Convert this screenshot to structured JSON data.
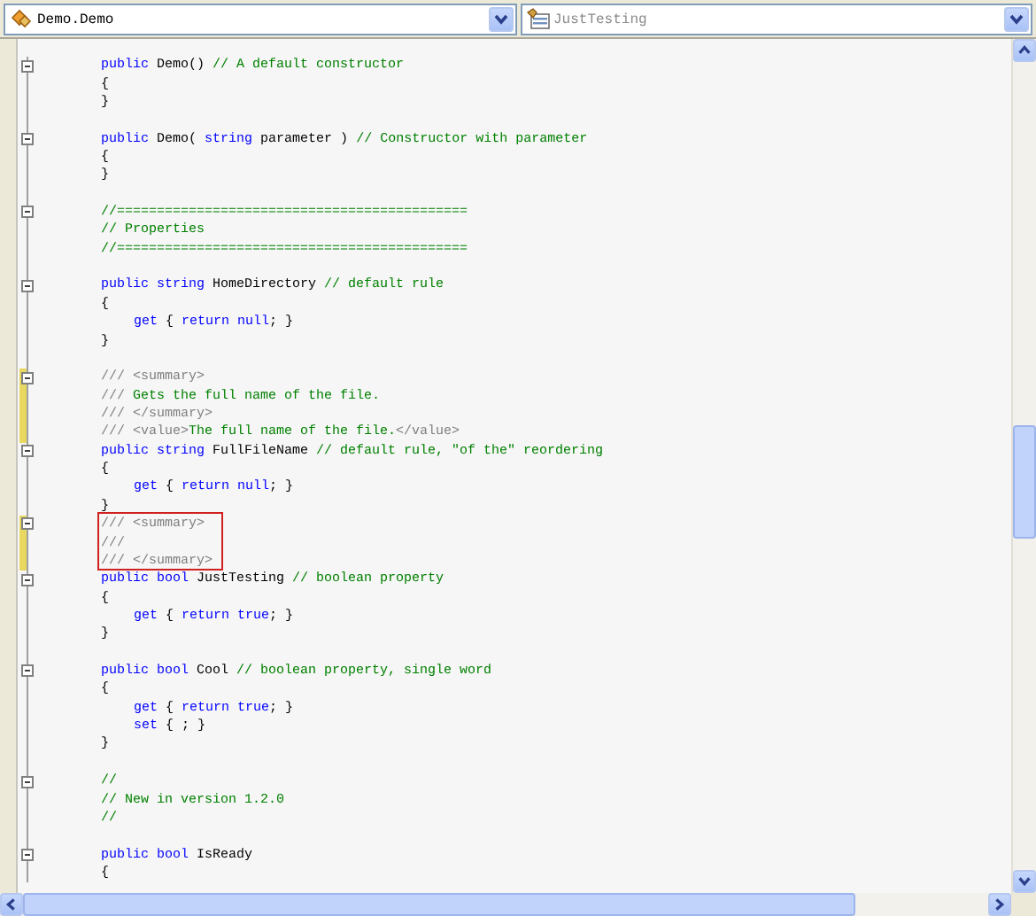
{
  "navigation_bar": {
    "type_dropdown": {
      "text": "Demo.Demo",
      "greyed": false
    },
    "member_dropdown": {
      "text": "JustTesting",
      "greyed": true
    }
  },
  "editor": {
    "lines": [
      {
        "fold": true,
        "modified": false,
        "boxed": false,
        "indented": false,
        "segments": [
          {
            "kind": "keyword",
            "text": "public"
          },
          {
            "kind": "plain",
            "text": " Demo() "
          },
          {
            "kind": "comment",
            "text": "// A default constructor"
          }
        ]
      },
      {
        "fold": false,
        "modified": false,
        "boxed": false,
        "indented": false,
        "segments": [
          {
            "kind": "plain",
            "text": "{"
          }
        ]
      },
      {
        "fold": false,
        "modified": false,
        "boxed": false,
        "indented": false,
        "segments": [
          {
            "kind": "plain",
            "text": "}"
          }
        ]
      },
      {
        "fold": false,
        "modified": false,
        "boxed": false
      },
      {
        "fold": true,
        "modified": false,
        "boxed": false,
        "indented": false,
        "segments": [
          {
            "kind": "keyword",
            "text": "public"
          },
          {
            "kind": "plain",
            "text": " Demo( "
          },
          {
            "kind": "keyword",
            "text": "string"
          },
          {
            "kind": "plain",
            "text": " parameter ) "
          },
          {
            "kind": "comment",
            "text": "// Constructor with parameter"
          }
        ]
      },
      {
        "fold": false,
        "modified": false,
        "boxed": false,
        "indented": false,
        "segments": [
          {
            "kind": "plain",
            "text": "{"
          }
        ]
      },
      {
        "fold": false,
        "modified": false,
        "boxed": false,
        "indented": false,
        "segments": [
          {
            "kind": "plain",
            "text": "}"
          }
        ]
      },
      {
        "fold": false,
        "modified": false,
        "boxed": false
      },
      {
        "fold": true,
        "modified": false,
        "boxed": false,
        "indented": false,
        "segments": [
          {
            "kind": "comment",
            "text": "//============================================"
          }
        ]
      },
      {
        "fold": false,
        "modified": false,
        "boxed": false,
        "indented": false,
        "segments": [
          {
            "kind": "comment",
            "text": "// Properties"
          }
        ]
      },
      {
        "fold": false,
        "modified": false,
        "boxed": false,
        "indented": false,
        "segments": [
          {
            "kind": "comment",
            "text": "//============================================"
          }
        ]
      },
      {
        "fold": false,
        "modified": false,
        "boxed": false
      },
      {
        "fold": true,
        "modified": false,
        "boxed": false,
        "indented": false,
        "segments": [
          {
            "kind": "keyword",
            "text": "public string"
          },
          {
            "kind": "plain",
            "text": " HomeDirectory "
          },
          {
            "kind": "comment",
            "text": "// default rule"
          }
        ]
      },
      {
        "fold": false,
        "modified": false,
        "boxed": false,
        "indented": false,
        "segments": [
          {
            "kind": "plain",
            "text": "{"
          }
        ]
      },
      {
        "fold": false,
        "modified": false,
        "boxed": false,
        "indented": true,
        "segments": [
          {
            "kind": "keyword",
            "text": "get"
          },
          {
            "kind": "plain",
            "text": " { "
          },
          {
            "kind": "keyword",
            "text": "return null"
          },
          {
            "kind": "plain",
            "text": "; }"
          }
        ]
      },
      {
        "fold": false,
        "modified": false,
        "boxed": false,
        "indented": false,
        "segments": [
          {
            "kind": "plain",
            "text": "}"
          }
        ]
      },
      {
        "fold": false,
        "modified": false,
        "boxed": false
      },
      {
        "fold": true,
        "modified": true,
        "boxed": false,
        "indented": false,
        "segments": [
          {
            "kind": "doc",
            "text": "/// <summary>"
          }
        ]
      },
      {
        "fold": false,
        "modified": true,
        "boxed": false,
        "indented": false,
        "segments": [
          {
            "kind": "doc",
            "text": "///"
          },
          {
            "kind": "comment",
            "text": " Gets the full name of the file."
          }
        ]
      },
      {
        "fold": false,
        "modified": true,
        "boxed": false,
        "indented": false,
        "segments": [
          {
            "kind": "doc",
            "text": "/// </summary>"
          }
        ]
      },
      {
        "fold": false,
        "modified": true,
        "boxed": false,
        "indented": false,
        "segments": [
          {
            "kind": "doc",
            "text": "/// <value>"
          },
          {
            "kind": "comment",
            "text": "The full name of the file."
          },
          {
            "kind": "doc",
            "text": "</value>"
          }
        ]
      },
      {
        "fold": true,
        "modified": false,
        "boxed": false,
        "indented": false,
        "segments": [
          {
            "kind": "keyword",
            "text": "public string"
          },
          {
            "kind": "plain",
            "text": " FullFileName "
          },
          {
            "kind": "comment",
            "text": "// default rule, \"of the\" reordering"
          }
        ]
      },
      {
        "fold": false,
        "modified": false,
        "boxed": false,
        "indented": false,
        "segments": [
          {
            "kind": "plain",
            "text": "{"
          }
        ]
      },
      {
        "fold": false,
        "modified": false,
        "boxed": false,
        "indented": true,
        "segments": [
          {
            "kind": "keyword",
            "text": "get"
          },
          {
            "kind": "plain",
            "text": " { "
          },
          {
            "kind": "keyword",
            "text": "return null"
          },
          {
            "kind": "plain",
            "text": "; }"
          }
        ]
      },
      {
        "fold": false,
        "modified": false,
        "boxed": false,
        "indented": false,
        "segments": [
          {
            "kind": "plain",
            "text": "}"
          }
        ]
      },
      {
        "fold": true,
        "modified": true,
        "boxed": true,
        "indented": false,
        "segments": [
          {
            "kind": "doc",
            "text": "/// <summary>"
          }
        ]
      },
      {
        "fold": false,
        "modified": true,
        "boxed": true,
        "indented": false,
        "segments": [
          {
            "kind": "doc",
            "text": "///"
          }
        ]
      },
      {
        "fold": false,
        "modified": true,
        "boxed": true,
        "indented": false,
        "segments": [
          {
            "kind": "doc",
            "text": "/// </summary>"
          }
        ]
      },
      {
        "fold": true,
        "modified": false,
        "boxed": false,
        "indented": false,
        "segments": [
          {
            "kind": "keyword",
            "text": "public bool"
          },
          {
            "kind": "plain",
            "text": " JustTesting "
          },
          {
            "kind": "comment",
            "text": "// boolean property"
          }
        ]
      },
      {
        "fold": false,
        "modified": false,
        "boxed": false,
        "indented": false,
        "segments": [
          {
            "kind": "plain",
            "text": "{"
          }
        ]
      },
      {
        "fold": false,
        "modified": false,
        "boxed": false,
        "indented": true,
        "segments": [
          {
            "kind": "keyword",
            "text": "get"
          },
          {
            "kind": "plain",
            "text": " { "
          },
          {
            "kind": "keyword",
            "text": "return true"
          },
          {
            "kind": "plain",
            "text": "; }"
          }
        ]
      },
      {
        "fold": false,
        "modified": false,
        "boxed": false,
        "indented": false,
        "segments": [
          {
            "kind": "plain",
            "text": "}"
          }
        ]
      },
      {
        "fold": false,
        "modified": false,
        "boxed": false
      },
      {
        "fold": true,
        "modified": false,
        "boxed": false,
        "indented": false,
        "segments": [
          {
            "kind": "keyword",
            "text": "public bool"
          },
          {
            "kind": "plain",
            "text": " Cool "
          },
          {
            "kind": "comment",
            "text": "// boolean property, single word"
          }
        ]
      },
      {
        "fold": false,
        "modified": false,
        "boxed": false,
        "indented": false,
        "segments": [
          {
            "kind": "plain",
            "text": "{"
          }
        ]
      },
      {
        "fold": false,
        "modified": false,
        "boxed": false,
        "indented": true,
        "segments": [
          {
            "kind": "keyword",
            "text": "get"
          },
          {
            "kind": "plain",
            "text": " { "
          },
          {
            "kind": "keyword",
            "text": "return true"
          },
          {
            "kind": "plain",
            "text": "; }"
          }
        ]
      },
      {
        "fold": false,
        "modified": false,
        "boxed": false,
        "indented": true,
        "segments": [
          {
            "kind": "keyword",
            "text": "set"
          },
          {
            "kind": "plain",
            "text": " { ; }"
          }
        ]
      },
      {
        "fold": false,
        "modified": false,
        "boxed": false,
        "indented": false,
        "segments": [
          {
            "kind": "plain",
            "text": "}"
          }
        ]
      },
      {
        "fold": false,
        "modified": false,
        "boxed": false
      },
      {
        "fold": true,
        "modified": false,
        "boxed": false,
        "indented": false,
        "segments": [
          {
            "kind": "comment",
            "text": "//"
          }
        ]
      },
      {
        "fold": false,
        "modified": false,
        "boxed": false,
        "indented": false,
        "segments": [
          {
            "kind": "comment",
            "text": "// New in version 1.2.0"
          }
        ]
      },
      {
        "fold": false,
        "modified": false,
        "boxed": false,
        "indented": false,
        "segments": [
          {
            "kind": "comment",
            "text": "//"
          }
        ]
      },
      {
        "fold": false,
        "modified": false,
        "boxed": false
      },
      {
        "fold": true,
        "modified": false,
        "boxed": false,
        "indented": false,
        "segments": [
          {
            "kind": "keyword",
            "text": "public bool"
          },
          {
            "kind": "plain",
            "text": " IsReady"
          }
        ]
      },
      {
        "fold": false,
        "modified": false,
        "boxed": false,
        "indented": false,
        "segments": [
          {
            "kind": "plain",
            "text": "{"
          }
        ]
      }
    ]
  }
}
